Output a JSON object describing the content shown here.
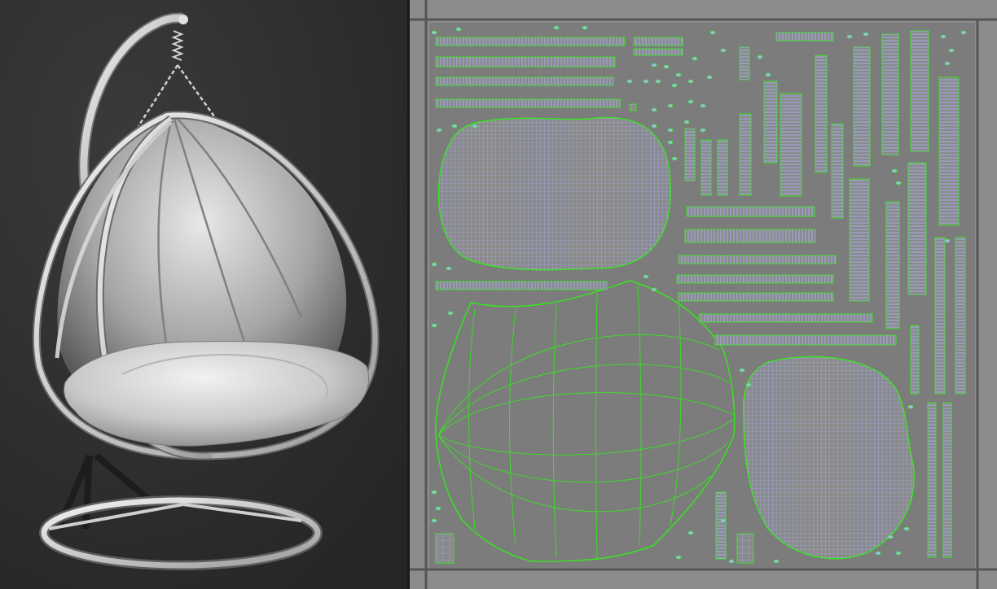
{
  "app": {
    "viewport": {
      "name": "perspective-viewport",
      "background": "#2e2e2e",
      "model": "hanging-egg-chair"
    },
    "uv_editor": {
      "background": "#8c8c8c",
      "grid_color": "#5c5c5c",
      "wire_color": "#a9b4ff",
      "seam_color": "#37e41f",
      "shell_fill": "#8a8a8a"
    }
  }
}
